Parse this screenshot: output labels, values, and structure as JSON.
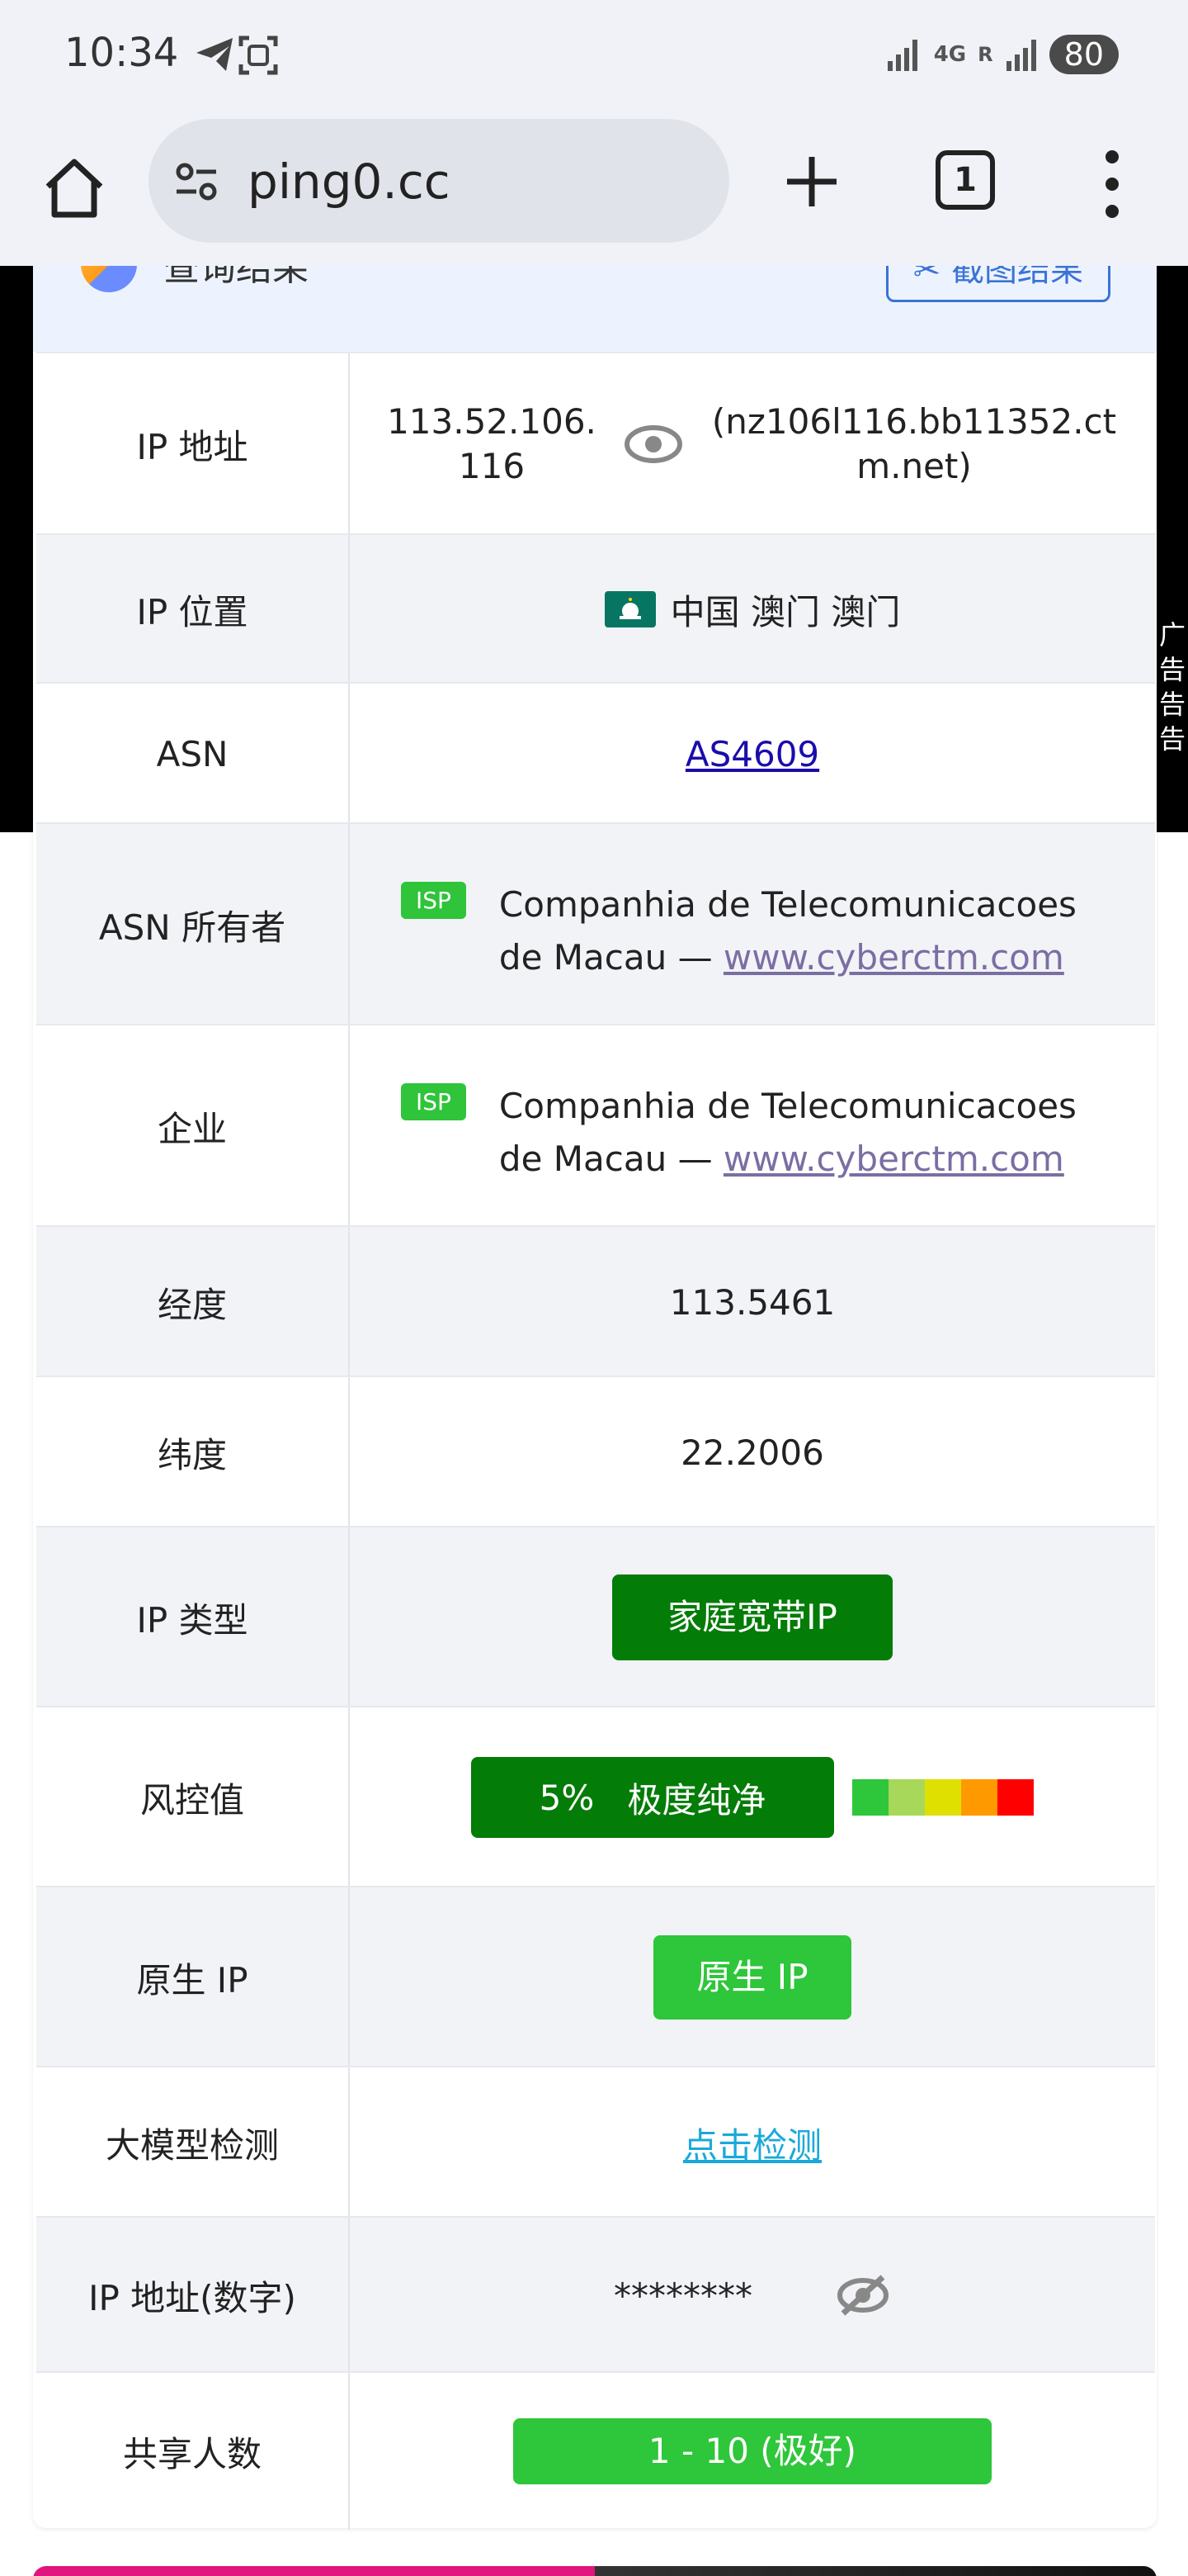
{
  "status_bar": {
    "time": "10:34",
    "network": "4G",
    "roaming": "R",
    "battery": "80"
  },
  "browser": {
    "url": "ping0.cc",
    "tab_count": "1"
  },
  "header": {
    "title": "查询结果",
    "screenshot_button": "截图结果"
  },
  "ad_label": "广告告告",
  "rows": {
    "ip_address": {
      "label": "IP 地址",
      "ip": "113.52.106.116",
      "hostname": "(nz106l116.bb11352.ctm.net)"
    },
    "ip_location": {
      "label": "IP 位置",
      "value": "中国 澳门 澳门"
    },
    "asn": {
      "label": "ASN",
      "value": "AS4609"
    },
    "asn_owner": {
      "label": "ASN 所有者",
      "badge": "ISP",
      "name": "Companhia de Telecomunicacoes de Macau",
      "dash": "—",
      "site": "www.cyberctm.com"
    },
    "enterprise": {
      "label": "企业",
      "badge": "ISP",
      "name": "Companhia de Telecomunicacoes de Macau",
      "dash": "—",
      "site": "www.cyberctm.com"
    },
    "longitude": {
      "label": "经度",
      "value": "113.5461"
    },
    "latitude": {
      "label": "纬度",
      "value": "22.2006"
    },
    "ip_type": {
      "label": "IP 类型",
      "value": "家庭宽带IP"
    },
    "risk_score": {
      "label": "风控值",
      "percent": "5%",
      "text": "极度纯净",
      "scale_colors": [
        "#2ec63a",
        "#a8d85a",
        "#e0e000",
        "#ff9900",
        "#ff0000"
      ]
    },
    "native_ip": {
      "label": "原生 IP",
      "value": "原生 IP"
    },
    "llm_detect": {
      "label": "大模型检测",
      "value": "点击检测"
    },
    "ip_numeric": {
      "label": "IP 地址(数字)",
      "value": "********"
    },
    "shared_users": {
      "label": "共享人数",
      "value": "1 - 10 (极好)"
    }
  }
}
